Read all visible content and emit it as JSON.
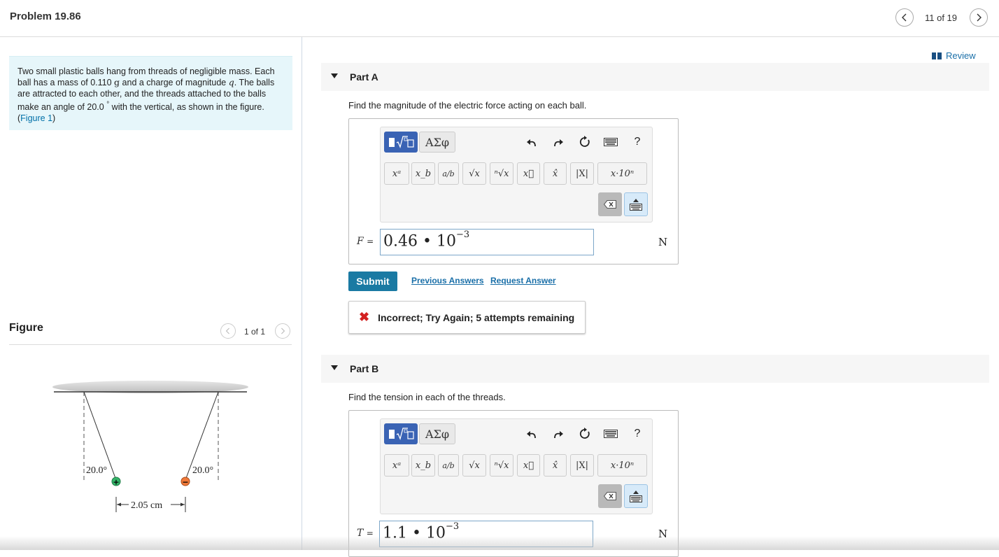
{
  "header": {
    "title": "Problem 19.86",
    "page_count": "11 of 19"
  },
  "problem": {
    "text_1": "Two small plastic balls hang from threads of negligible mass. Each ball has a mass of 0.110 ",
    "unit_g": "g",
    "text_2": " and a charge of magnitude ",
    "var_q": "q",
    "text_3": ". The balls are attracted to each other, and the threads attached to the balls make an angle of 20.0 ",
    "degree": "°",
    "text_4": " with the vertical, as shown in the figure.(",
    "figure_link": "Figure 1",
    "text_5": ")"
  },
  "figure": {
    "title": "Figure",
    "count": "1 of 1",
    "angle_left": "20.0°",
    "angle_right": "20.0°",
    "distance": "2.05 cm",
    "plus": "+",
    "minus": "−"
  },
  "review": {
    "label": "Review"
  },
  "toolbar": {
    "greek": "ΑΣφ",
    "help": "?",
    "symbols": [
      "xᵃ",
      "x_b",
      "a/b",
      "√x",
      "ⁿ√x",
      "x⃗",
      "x̂",
      "|X|",
      "x·10ⁿ"
    ]
  },
  "part_a": {
    "label": "Part A",
    "question": "Find the magnitude of the electric force acting on each ball.",
    "var": "F",
    "equals": "=",
    "answer_mantissa": "0.46 • 10",
    "answer_exponent": "−3",
    "unit": "N",
    "submit": "Submit",
    "previous_answers": "Previous Answers",
    "request_answer": "Request Answer",
    "feedback": "Incorrect; Try Again; 5 attempts remaining",
    "feedback_icon": "✖"
  },
  "part_b": {
    "label": "Part B",
    "question": "Find the tension in each of the threads.",
    "var": "T",
    "equals": "=",
    "answer_mantissa": "1.1 • 10",
    "answer_exponent": "−3",
    "unit": "N"
  },
  "colors": {
    "accent": "#1a7aa3",
    "problem_bg": "#e6f6fa",
    "template_button": "#3a63b4",
    "error": "#d32121",
    "link": "#1a6fa8"
  }
}
